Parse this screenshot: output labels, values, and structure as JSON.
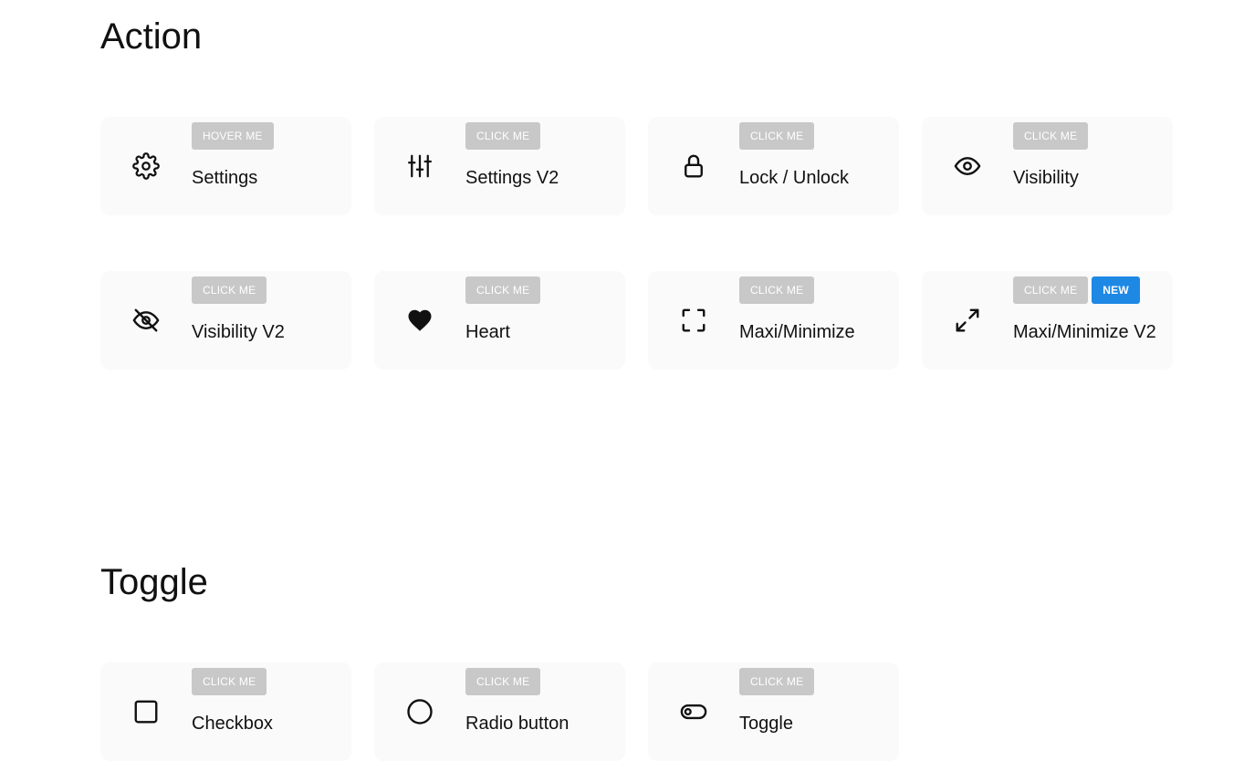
{
  "sections": {
    "action": {
      "title": "Action",
      "cards": [
        {
          "icon": "gear-icon",
          "badge": "HOVER ME",
          "label": "Settings"
        },
        {
          "icon": "sliders-icon",
          "badge": "CLICK ME",
          "label": "Settings V2"
        },
        {
          "icon": "lock-icon",
          "badge": "CLICK ME",
          "label": "Lock / Unlock"
        },
        {
          "icon": "eye-icon",
          "badge": "CLICK ME",
          "label": "Visibility"
        },
        {
          "icon": "eye-off-icon",
          "badge": "CLICK ME",
          "label": "Visibility V2"
        },
        {
          "icon": "heart-icon",
          "badge": "CLICK ME",
          "label": "Heart"
        },
        {
          "icon": "fullscreen-corners-icon",
          "badge": "CLICK ME",
          "label": "Maxi/Minimize"
        },
        {
          "icon": "expand-arrows-icon",
          "badge": "CLICK ME",
          "badge_new": "NEW",
          "label": "Maxi/Minimize V2"
        }
      ]
    },
    "toggle": {
      "title": "Toggle",
      "cards": [
        {
          "icon": "checkbox-icon",
          "badge": "CLICK ME",
          "label": "Checkbox"
        },
        {
          "icon": "radio-icon",
          "badge": "CLICK ME",
          "label": "Radio button"
        },
        {
          "icon": "toggle-switch-icon",
          "badge": "CLICK ME",
          "label": "Toggle"
        }
      ]
    }
  },
  "colors": {
    "card_bg": "#fafafa",
    "badge_bg": "#c8c8c8",
    "badge_new_bg": "#1e88e5"
  }
}
